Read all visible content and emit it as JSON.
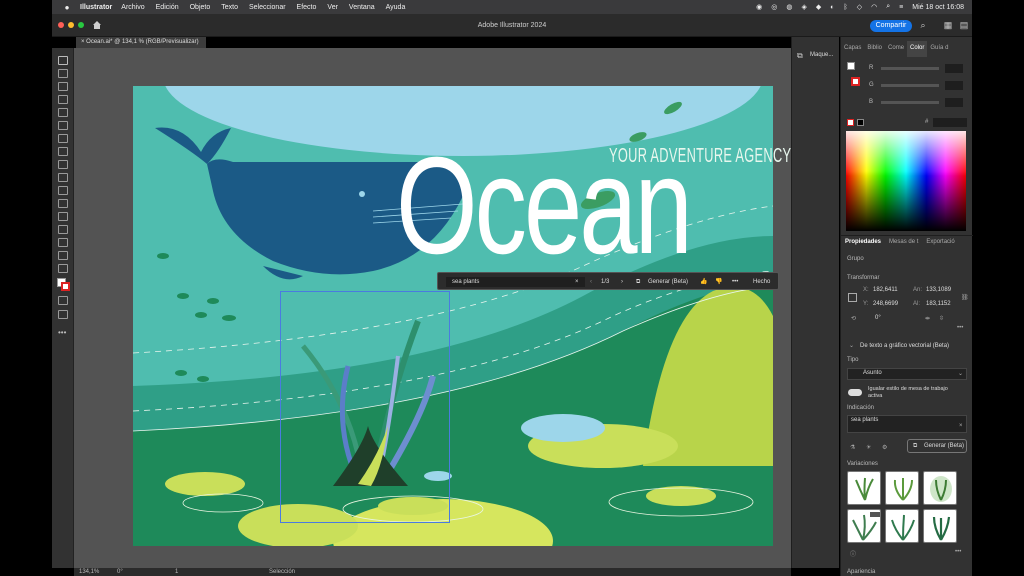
{
  "menubar": {
    "app": "Illustrator",
    "items": [
      "Archivo",
      "Edición",
      "Objeto",
      "Texto",
      "Seleccionar",
      "Efecto",
      "Ver",
      "Ventana",
      "Ayuda"
    ],
    "clock": "Mié 18 oct  16:08"
  },
  "window": {
    "title": "Adobe Illustrator 2024",
    "share_label": "Compartir",
    "doc_tab": "Ocean.ai* @ 134,1 % (RGB/Previsualizar)"
  },
  "dock": {
    "label": "Maque..."
  },
  "artwork": {
    "tagline": "YOUR ADVENTURE AGENCY",
    "headline": "Ocean"
  },
  "context_bar": {
    "prompt": "sea plants",
    "counter": "1/3",
    "generate": "Generar (Beta)",
    "done": "Hecho"
  },
  "color_panel": {
    "tabs": [
      "Capas",
      "Biblio",
      "Come",
      "Color",
      "Guía d"
    ],
    "active_tab": "Color",
    "channels": [
      "R",
      "G",
      "B"
    ],
    "hex_symbol": "#"
  },
  "properties": {
    "tabs": [
      "Propiedades",
      "Mesas de t",
      "Exportació"
    ],
    "group_label": "Grupo",
    "transform_label": "Transformar",
    "x_label": "X:",
    "x": "182,6411",
    "y_label": "Y:",
    "y": "248,6699",
    "w_label": "An:",
    "w": "133,1089",
    "h_label": "Al:",
    "h": "183,1152",
    "angle": "0°",
    "section_title": "De texto a gráfico vectorial (Beta)",
    "type_label": "Tipo",
    "type_value": "Asunto",
    "match_style": "Igualar estilo de mesa de trabajo activa",
    "prompt_label": "Indicación",
    "prompt_value": "sea plants",
    "generate_label": "Generar (Beta)",
    "variations_label": "Variaciones",
    "appearance_label": "Apariencia"
  },
  "statusbar": {
    "zoom": "134,1%",
    "rotation": "0°",
    "artboard": "1",
    "tool": "Selección"
  },
  "colors": {
    "sky": "#9dd6ea",
    "teal": "#4fbdaf",
    "deep_green": "#1e8a5a",
    "whale": "#1b5a86",
    "lime": "#c9df5a",
    "accent_blue": "#1473e6"
  }
}
